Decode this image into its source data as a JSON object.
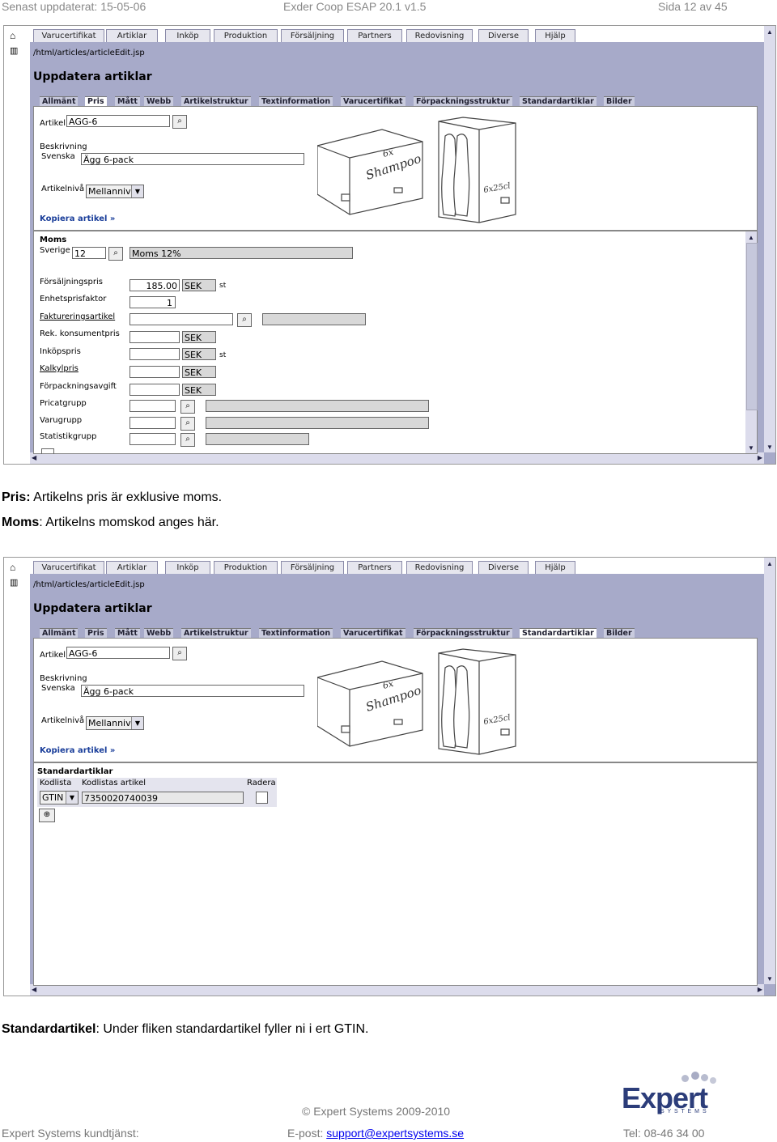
{
  "header": {
    "left": "Senast uppdaterat: 15-05-06",
    "center": "Exder Coop ESAP 20.1 v1.5",
    "right": "Sida 12 av 45"
  },
  "menu": [
    "Varucertifikat",
    "Artiklar",
    "Inköp",
    "Produktion",
    "Försäljning",
    "Partners",
    "Redovisning",
    "Diverse",
    "Hjälp"
  ],
  "path": "/html/articles/articleEdit.jsp",
  "page_title": "Uppdatera artiklar",
  "subtabs": [
    "Allmänt",
    "Pris",
    "Mått",
    "Webb",
    "Artikelstruktur",
    "Textinformation",
    "Varucertifikat",
    "Förpackningsstruktur",
    "Standardartiklar",
    "Bilder"
  ],
  "article": {
    "artikel_label": "Artikel",
    "artikel_value": "AGG-6",
    "beskrivning_label": "Beskrivning",
    "svenska_label": "Svenska",
    "svenska_value": "Ägg 6-pack",
    "niva_label": "Artikelnivå",
    "niva_value": "Mellannivå",
    "copy_link": "Kopiera artikel »"
  },
  "box_text": {
    "a": "6x",
    "b": "Shampoo",
    "c": "6x25cl"
  },
  "pris": {
    "moms_heading": "Moms",
    "sverige_label": "Sverige",
    "moms_code": "12",
    "moms_desc": "Moms 12%",
    "rows": [
      {
        "label": "Försäljningspris",
        "value": "185.00",
        "cur": "SEK",
        "unit": "st"
      },
      {
        "label": "Enhetsprisfaktor",
        "value": "1"
      },
      {
        "label": "Faktureringsartikel"
      },
      {
        "label": "Rek. konsumentpris",
        "cur": "SEK"
      },
      {
        "label": "Inköpspris",
        "cur": "SEK",
        "unit": "st"
      },
      {
        "label": "Kalkylpris",
        "cur": "SEK"
      },
      {
        "label": "Förpackningsavgift",
        "cur": "SEK"
      },
      {
        "label": "Pricatgrupp"
      },
      {
        "label": "Varugrupp"
      },
      {
        "label": "Statistikgrupp"
      }
    ]
  },
  "caption1": {
    "b1": "Pris:",
    "t1": " Artikelns pris är exklusive moms.",
    "b2": "Moms",
    "t2": ": Artikelns momskod anges här."
  },
  "std": {
    "heading": "Standardartiklar",
    "col1": "Kodlista",
    "col2": "Kodlistas artikel",
    "col3": "Radera",
    "kod": "GTIN",
    "value": "7350020740039"
  },
  "caption2": {
    "b": "Standardartikel",
    "t": ": Under fliken standardartikel fyller ni i ert GTIN."
  },
  "footer": {
    "copyright": "© Expert Systems 2009-2010",
    "left": "Expert Systems kundtjänst:",
    "email_label": "E-post: ",
    "email": "support@expertsystems.se",
    "tel": "Tel: 08-46 34 00",
    "logo": "Expert",
    "logo_sub": "S Y S T E M S"
  },
  "colors": {
    "frame": "#a7aac9",
    "link": "#1a3e9a",
    "logo": "#2c3d7a"
  }
}
